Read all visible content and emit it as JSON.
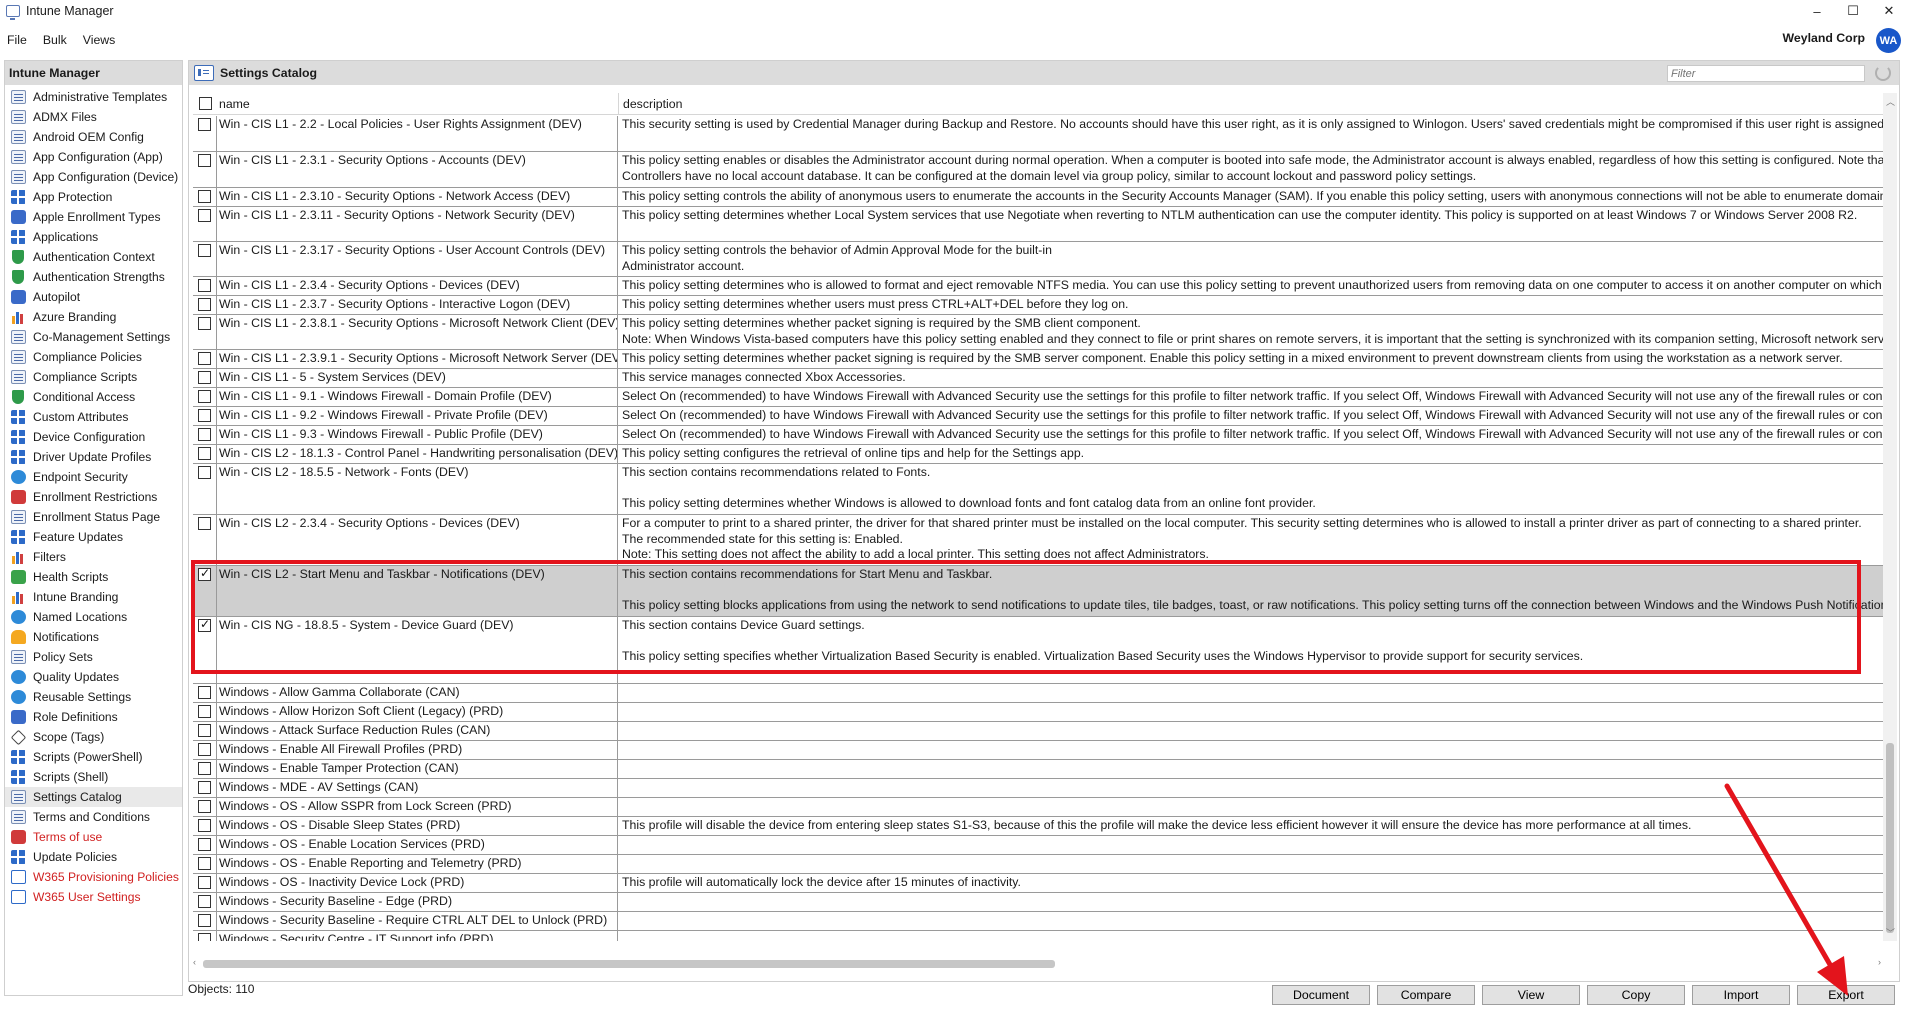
{
  "window": {
    "title": "Intune Manager",
    "minimize": "–",
    "maximize": "☐",
    "close": "✕"
  },
  "menu": [
    "File",
    "Bulk",
    "Views"
  ],
  "account": {
    "org": "Weyland Corp",
    "initials": "WA"
  },
  "sidebar": {
    "title": "Intune Manager",
    "items": [
      {
        "label": "Administrative Templates",
        "icon": "doc-icon",
        "cls": "ic-doc"
      },
      {
        "label": "ADMX Files",
        "icon": "doc-icon",
        "cls": "ic-doc"
      },
      {
        "label": "Android OEM Config",
        "icon": "doc-icon",
        "cls": "ic-doc"
      },
      {
        "label": "App Configuration (App)",
        "icon": "doc-icon",
        "cls": "ic-doc"
      },
      {
        "label": "App Configuration (Device)",
        "icon": "doc-icon",
        "cls": "ic-doc"
      },
      {
        "label": "App Protection",
        "icon": "grid-icon",
        "cls": "ic-grid"
      },
      {
        "label": "Apple Enrollment Types",
        "icon": "people-icon",
        "cls": "ic-cap"
      },
      {
        "label": "Applications",
        "icon": "grid-icon",
        "cls": "ic-grid"
      },
      {
        "label": "Authentication Context",
        "icon": "shield-icon",
        "cls": "ic-shield"
      },
      {
        "label": "Authentication Strengths",
        "icon": "shield-icon",
        "cls": "ic-shield"
      },
      {
        "label": "Autopilot",
        "icon": "autopilot-icon",
        "cls": "ic-cap"
      },
      {
        "label": "Azure Branding",
        "icon": "chart-icon",
        "cls": "ic-bars"
      },
      {
        "label": "Co-Management Settings",
        "icon": "doc-icon",
        "cls": "ic-doc"
      },
      {
        "label": "Compliance Policies",
        "icon": "doc-icon",
        "cls": "ic-doc"
      },
      {
        "label": "Compliance Scripts",
        "icon": "doc-icon",
        "cls": "ic-doc"
      },
      {
        "label": "Conditional Access",
        "icon": "shield-icon",
        "cls": "ic-shield"
      },
      {
        "label": "Custom Attributes",
        "icon": "grid-icon",
        "cls": "ic-grid"
      },
      {
        "label": "Device Configuration",
        "icon": "grid-icon",
        "cls": "ic-grid"
      },
      {
        "label": "Driver Update Profiles",
        "icon": "grid-icon",
        "cls": "ic-grid"
      },
      {
        "label": "Endpoint Security",
        "icon": "globe-icon",
        "cls": "ic-globe"
      },
      {
        "label": "Enrollment Restrictions",
        "icon": "restriction-icon",
        "cls": "ic-red"
      },
      {
        "label": "Enrollment Status Page",
        "icon": "doc-icon",
        "cls": "ic-doc"
      },
      {
        "label": "Feature Updates",
        "icon": "grid-icon",
        "cls": "ic-grid"
      },
      {
        "label": "Filters",
        "icon": "chart-icon",
        "cls": "ic-bars"
      },
      {
        "label": "Health Scripts",
        "icon": "health-icon",
        "cls": "ic-green"
      },
      {
        "label": "Intune Branding",
        "icon": "chart-icon",
        "cls": "ic-bars"
      },
      {
        "label": "Named Locations",
        "icon": "location-icon",
        "cls": "ic-globe"
      },
      {
        "label": "Notifications",
        "icon": "bell-icon",
        "cls": "ic-bell"
      },
      {
        "label": "Policy Sets",
        "icon": "doc-icon",
        "cls": "ic-doc"
      },
      {
        "label": "Quality Updates",
        "icon": "globe-icon",
        "cls": "ic-globe"
      },
      {
        "label": "Reusable Settings",
        "icon": "gear-icon",
        "cls": "ic-globe"
      },
      {
        "label": "Role Definitions",
        "icon": "role-icon",
        "cls": "ic-cap"
      },
      {
        "label": "Scope (Tags)",
        "icon": "tag-icon",
        "cls": "ic-scope"
      },
      {
        "label": "Scripts (PowerShell)",
        "icon": "grid-icon",
        "cls": "ic-grid"
      },
      {
        "label": "Scripts (Shell)",
        "icon": "grid-icon",
        "cls": "ic-grid"
      },
      {
        "label": "Settings Catalog",
        "icon": "doc-icon",
        "cls": "ic-doc",
        "selected": true
      },
      {
        "label": "Terms and Conditions",
        "icon": "doc-icon",
        "cls": "ic-doc"
      },
      {
        "label": "Terms of use",
        "icon": "terms-icon",
        "cls": "ic-red",
        "red": true
      },
      {
        "label": "Update Policies",
        "icon": "grid-icon",
        "cls": "ic-grid"
      },
      {
        "label": "W365 Provisioning Policies",
        "icon": "w365-icon",
        "cls": "ic-redbox",
        "red": true
      },
      {
        "label": "W365 User Settings",
        "icon": "w365-icon",
        "cls": "ic-redbox",
        "red": true
      }
    ]
  },
  "panel": {
    "title": "Settings Catalog",
    "filter_placeholder": "Filter"
  },
  "table": {
    "columns": {
      "name": "name",
      "description": "description"
    },
    "rows": [
      {
        "h": 36,
        "checked": false,
        "name": "Win - CIS L1 - 2.2 - Local Policies - User Rights Assignment (DEV)",
        "desc": "This security setting is used by Credential Manager during Backup and Restore. No accounts should have this user right, as it is only assigned to Winlogon. Users' saved credentials might be compromised if this user right is assigned to othe"
      },
      {
        "h": 36,
        "checked": false,
        "name": "Win - CIS L1 - 2.3.1 - Security Options - Accounts (DEV)",
        "desc": "This policy setting enables or disables the Administrator account during normal operation. When a computer is booted into safe mode, the Administrator account is always enabled, regardless of how this setting is configured. Note that this\nControllers have no local account database. It can be configured at the domain level via group policy, similar to account lockout and password policy settings."
      },
      {
        "h": 19,
        "checked": false,
        "name": "Win - CIS L1 - 2.3.10 - Security Options - Network Access (DEV)",
        "desc": "This policy setting controls the ability of anonymous users to enumerate the accounts in the Security Accounts Manager (SAM). If you enable this policy setting, users with anonymous connections will not be able to enumerate domain accou"
      },
      {
        "h": 35,
        "checked": false,
        "name": "Win - CIS L1 - 2.3.11 - Security Options - Network Security (DEV)",
        "desc": "This policy setting determines whether Local System services that use Negotiate when reverting to NTLM authentication can use the computer identity. This policy is supported on at least Windows 7 or Windows Server 2008 R2."
      },
      {
        "h": 35,
        "checked": false,
        "name": "Win - CIS L1 - 2.3.17 - Security Options - User Account Controls (DEV)",
        "desc": "This policy setting controls the behavior of Admin Approval Mode for the built-in\nAdministrator account."
      },
      {
        "h": 19,
        "checked": false,
        "name": "Win - CIS L1 - 2.3.4 - Security Options - Devices (DEV)",
        "desc": "This policy setting determines who is allowed to format and eject removable NTFS media. You can use this policy setting to prevent unauthorized users from removing data on one computer to access it on another computer on which they h"
      },
      {
        "h": 19,
        "checked": false,
        "name": "Win - CIS L1 - 2.3.7 - Security Options - Interactive Logon (DEV)",
        "desc": "This policy setting determines whether users must press CTRL+ALT+DEL before they log on."
      },
      {
        "h": 35,
        "checked": false,
        "name": "Win - CIS L1 - 2.3.8.1 - Security Options - Microsoft Network Client (DEV)",
        "desc": "This policy setting determines whether packet signing is required by the SMB client component.\nNote: When Windows Vista-based computers have this policy setting enabled and they connect to file or print shares on remote servers, it is important that the setting is synchronized with its companion setting, Microsoft network server: D"
      },
      {
        "h": 19,
        "checked": false,
        "name": "Win - CIS L1 - 2.3.9.1 - Security Options - Microsoft Network Server (DEV)",
        "desc": "This policy setting determines whether packet signing is required by the SMB server component. Enable this policy setting in a mixed environment to prevent downstream clients from using the workstation as a network server."
      },
      {
        "h": 19,
        "checked": false,
        "name": "Win - CIS L1 - 5 - System Services (DEV)",
        "desc": "This service manages connected Xbox Accessories."
      },
      {
        "h": 19,
        "checked": false,
        "name": "Win - CIS L1 - 9.1 - Windows Firewall - Domain Profile (DEV)",
        "desc": "Select On (recommended) to have Windows Firewall with Advanced Security use the settings for this profile to filter network traffic. If you select Off, Windows Firewall with Advanced Security will not use any of the firewall rules or connectio"
      },
      {
        "h": 19,
        "checked": false,
        "name": "Win - CIS L1 - 9.2 - Windows Firewall - Private Profile (DEV)",
        "desc": "Select On (recommended) to have Windows Firewall with Advanced Security use the settings for this profile to filter network traffic. If you select Off, Windows Firewall with Advanced Security will not use any of the firewall rules or connectio"
      },
      {
        "h": 19,
        "checked": false,
        "name": "Win - CIS L1 - 9.3 - Windows Firewall - Public Profile (DEV)",
        "desc": "Select On (recommended) to have Windows Firewall with Advanced Security use the settings for this profile to filter network traffic. If you select Off, Windows Firewall with Advanced Security will not use any of the firewall rules or connectio"
      },
      {
        "h": 19,
        "checked": false,
        "name": "Win - CIS L2 - 18.1.3 - Control Panel - Handwriting personalisation (DEV)",
        "desc": "This policy setting configures the retrieval of online tips and help for the Settings app."
      },
      {
        "h": 51,
        "checked": false,
        "name": "Win - CIS L2 - 18.5.5 - Network - Fonts (DEV)",
        "desc": "This section contains recommendations related to Fonts.\n\nThis policy setting determines whether Windows is allowed to download fonts and font catalog data from an online font provider."
      },
      {
        "h": 51,
        "checked": false,
        "name": "Win - CIS L2 - 2.3.4 - Security Options - Devices (DEV)",
        "desc": "For a computer to print to a shared printer, the driver for that shared printer must be installed on the local computer. This security setting determines who is allowed to install a printer driver as part of connecting to a shared printer.\nThe recommended state for this setting is: Enabled.\nNote: This setting does not affect the ability to add a local printer. This setting does not affect Administrators."
      },
      {
        "h": 51,
        "checked": true,
        "sel": true,
        "name": "Win - CIS L2 - Start Menu and Taskbar - Notifications (DEV)",
        "desc": "This section contains recommendations for Start Menu and Taskbar.\n\nThis policy setting blocks applications from using the network to send notifications to update tiles, tile badges, toast, or raw notifications. This policy setting turns off the connection between Windows and the Windows Push Notification Ser"
      },
      {
        "h": 67,
        "checked": true,
        "name": "Win - CIS NG - 18.8.5 - System - Device Guard (DEV)",
        "desc": "This section contains Device Guard settings.\n\nThis policy setting specifies whether Virtualization Based Security is enabled. Virtualization Based Security uses the Windows Hypervisor to provide support for security services."
      },
      {
        "h": 19,
        "checked": false,
        "name": "Windows  - Allow Gamma Collaborate (CAN)",
        "desc": ""
      },
      {
        "h": 19,
        "checked": false,
        "name": "Windows - Allow Horizon Soft Client (Legacy) (PRD)",
        "desc": ""
      },
      {
        "h": 19,
        "checked": false,
        "name": "Windows - Attack Surface Reduction Rules (CAN)",
        "desc": ""
      },
      {
        "h": 19,
        "checked": false,
        "name": "Windows - Enable All Firewall Profiles (PRD)",
        "desc": ""
      },
      {
        "h": 19,
        "checked": false,
        "name": "Windows - Enable Tamper Protection (CAN)",
        "desc": ""
      },
      {
        "h": 19,
        "checked": false,
        "name": "Windows - MDE - AV Settings (CAN)",
        "desc": ""
      },
      {
        "h": 19,
        "checked": false,
        "name": "Windows - OS - Allow SSPR from Lock Screen (PRD)",
        "desc": ""
      },
      {
        "h": 19,
        "checked": false,
        "name": "Windows - OS - Disable Sleep States (PRD)",
        "desc": "This profile will disable the device from entering sleep states S1-S3, because of this the profile will make the device less efficient however it will ensure the device has more performance at all times."
      },
      {
        "h": 19,
        "checked": false,
        "name": "Windows - OS - Enable Location Services (PRD)",
        "desc": ""
      },
      {
        "h": 19,
        "checked": false,
        "name": "Windows - OS - Enable Reporting and Telemetry (PRD)",
        "desc": ""
      },
      {
        "h": 19,
        "checked": false,
        "name": "Windows - OS - Inactivity Device Lock (PRD)",
        "desc": "This profile will automatically lock the device after 15 minutes of inactivity."
      },
      {
        "h": 19,
        "checked": false,
        "name": "Windows - Security Baseline - Edge (PRD)",
        "desc": ""
      },
      {
        "h": 19,
        "checked": false,
        "name": "Windows - Security Baseline - Require CTRL ALT DEL to Unlock (PRD)",
        "desc": ""
      },
      {
        "h": 19,
        "checked": false,
        "name": "Windows - Security Centre - IT Support info (PRD)",
        "desc": ""
      }
    ]
  },
  "status": {
    "objects": "Objects: 110"
  },
  "buttons": [
    "Document",
    "Compare",
    "View",
    "Copy",
    "Import",
    "Export"
  ],
  "annotation_color": "#e3141c"
}
